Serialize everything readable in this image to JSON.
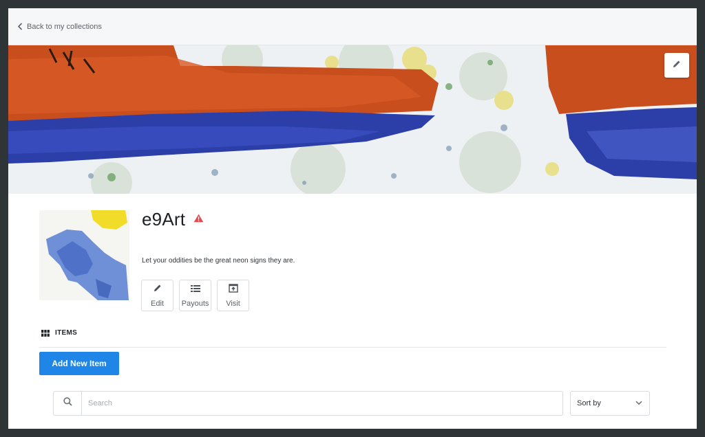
{
  "nav": {
    "back_label": "Back to my collections",
    "back_icon": "chevron-left-icon"
  },
  "banner": {
    "edit_icon": "pencil-icon"
  },
  "profile": {
    "name": "e9Art",
    "warning_icon": "warning-triangle-icon",
    "warning_color": "#e5484d",
    "tagline": "Let your oddities be the great neon signs they are.",
    "actions": [
      {
        "label": "Edit",
        "icon": "pencil-icon"
      },
      {
        "label": "Payouts",
        "icon": "list-icon"
      },
      {
        "label": "Visit",
        "icon": "external-link-icon"
      }
    ]
  },
  "items_section": {
    "title": "ITEMS",
    "icon": "grid-icon",
    "add_button_label": "Add New Item",
    "accent_color": "#1f86e8"
  },
  "search": {
    "placeholder": "Search",
    "value": ""
  },
  "sort": {
    "label": "Sort by"
  }
}
